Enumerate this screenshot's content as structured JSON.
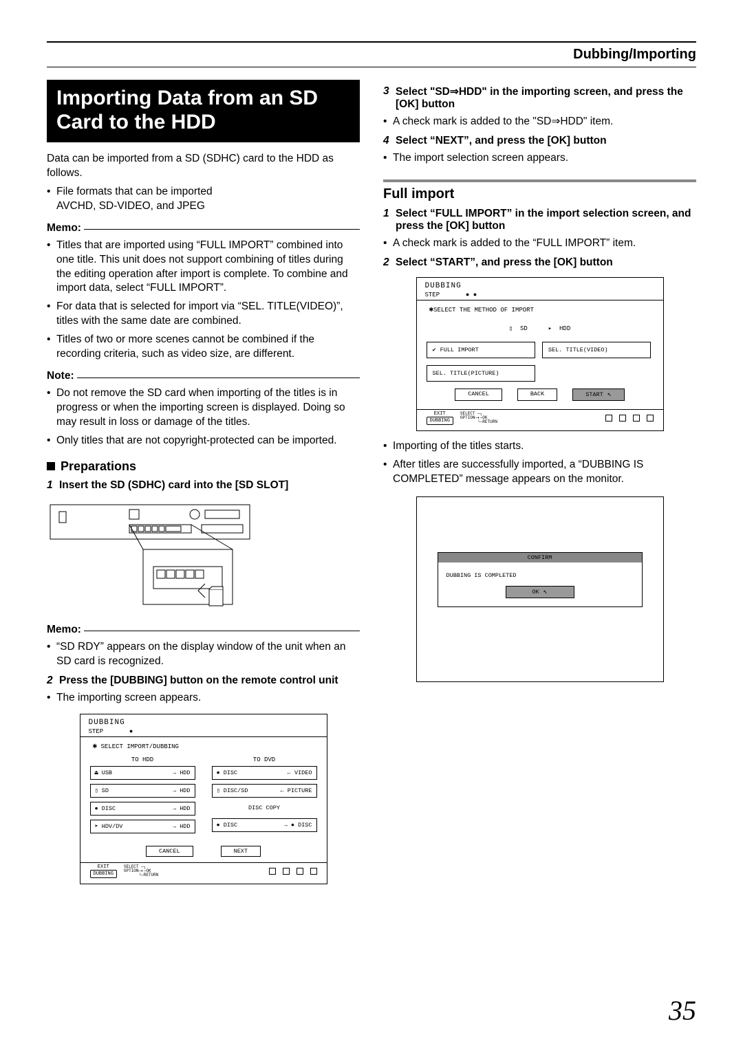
{
  "header": {
    "category": "Dubbing/Importing"
  },
  "left": {
    "title": "Importing Data from an SD Card to the HDD",
    "intro": "Data can be imported from a SD (SDHC) card to the HDD as follows.",
    "formats_l1": "File formats that can be imported",
    "formats_l2": "AVCHD, SD-VIDEO, and JPEG",
    "memo_label": "Memo:",
    "memo1": "Titles that are imported using “FULL IMPORT” combined into one title. This unit does not support combining of titles during the editing operation after import is complete. To combine and import data, select “FULL IMPORT”.",
    "memo2": "For data that is selected for import via “SEL. TITLE(VIDEO)”, titles with the same date are combined.",
    "memo3": "Titles of two or more scenes cannot be combined if the recording criteria, such as video size, are different.",
    "note_label": "Note:",
    "note1": "Do not remove the SD card when importing of the titles is in progress or when the importing screen is displayed. Doing so may result in loss or damage of the titles.",
    "note2": "Only titles that are not copyright-protected can be imported.",
    "prep_h": "Preparations",
    "step1": "Insert the SD (SDHC) card into the [SD SLOT]",
    "memo2_label": "Memo:",
    "memo_sd": "“SD RDY” appears on the display window of the unit when an SD card is recognized.",
    "step2": "Press the [DUBBING] button on the remote control unit",
    "step2_b": "The importing screen appears.",
    "screen1": {
      "title": "DUBBING",
      "step": "STEP",
      "sel": "SELECT IMPORT/DUBBING",
      "to_hdd": "TO HDD",
      "to_dvd": "TO DVD",
      "usb": "USB",
      "hdd": "HDD",
      "sd": "SD",
      "disc": "DISC",
      "hdvdv": "HDV/DV",
      "video": "VIDEO",
      "discsd": "DISC/SD",
      "picture": "PICTURE",
      "disccopy": "DISC COPY",
      "cancel": "CANCEL",
      "next": "NEXT",
      "exit": "EXIT",
      "dub": "DUBBING",
      "select": "SELECT",
      "ok": "OK",
      "return": "RETURN",
      "option": "OPTION"
    }
  },
  "right": {
    "step3": "Select \"SD⇒HDD\" in the importing screen, and press the [OK] button",
    "step3_b": "A check mark is added to the \"SD⇒HDD\" item.",
    "step4": "Select “NEXT”, and press the [OK] button",
    "step4_b": "The import selection screen appears.",
    "full_h": "Full import",
    "fstep1": "Select “FULL IMPORT” in the import selection screen, and press the [OK] button",
    "fstep1_b": "A check mark is added to the “FULL IMPORT” item.",
    "fstep2": "Select “START”, and press the [OK] button",
    "screen2": {
      "title": "DUBBING",
      "step": "STEP",
      "sel": "SELECT THE METHOD OF IMPORT",
      "sd": "SD",
      "hdd": "HDD",
      "full": "FULL IMPORT",
      "selv": "SEL. TITLE(VIDEO)",
      "selp": "SEL. TITLE(PICTURE)",
      "cancel": "CANCEL",
      "back": "BACK",
      "start": "START",
      "exit": "EXIT",
      "dub": "DUBBING"
    },
    "after1": "Importing of the titles starts.",
    "after2": "After titles are successfully imported, a “DUBBING IS COMPLETED” message appears on the monitor.",
    "confirm": {
      "h": "CONFIRM",
      "msg": "DUBBING IS COMPLETED",
      "ok": "OK"
    }
  },
  "page_number": "35"
}
